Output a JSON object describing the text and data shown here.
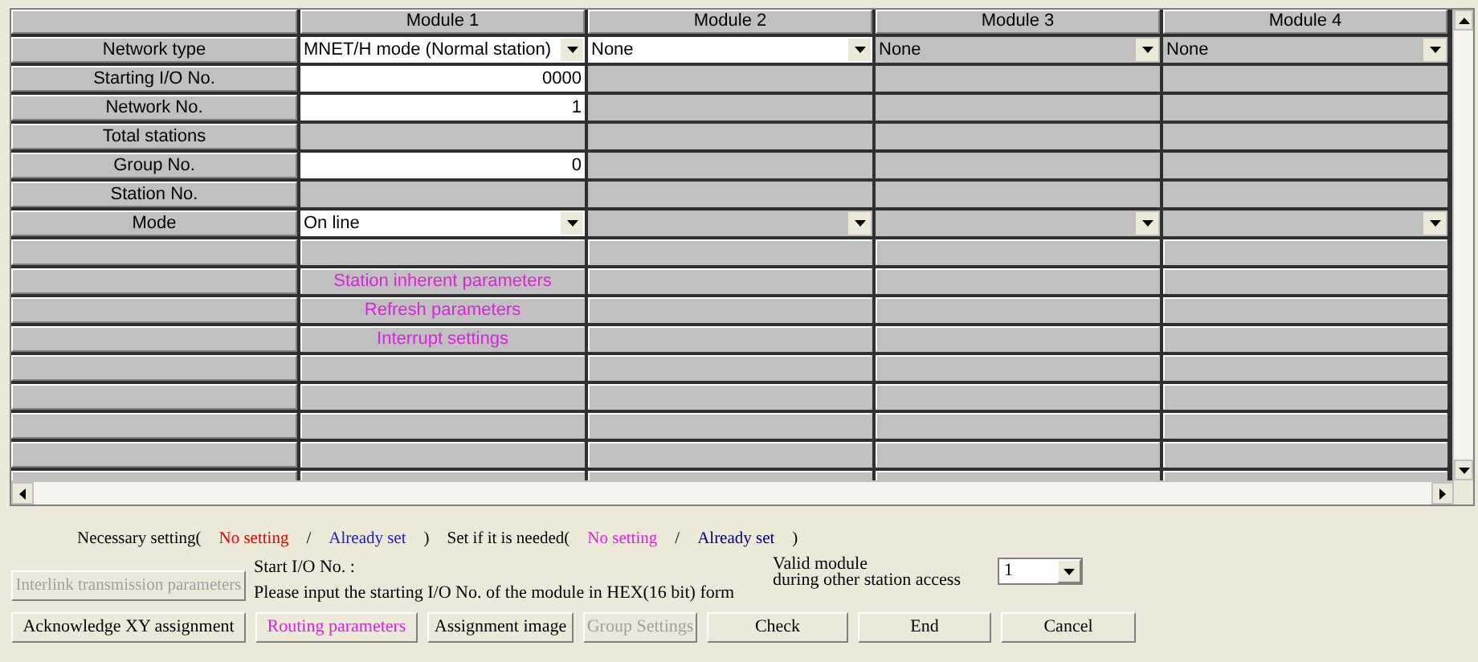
{
  "table": {
    "columns": [
      "Module 1",
      "Module 2",
      "Module 3",
      "Module 4"
    ],
    "rows": [
      {
        "label": "Network type",
        "cells": [
          {
            "kind": "select",
            "value": "MNET/H mode (Normal station)",
            "disabled": false
          },
          {
            "kind": "select",
            "value": "None",
            "disabled": false
          },
          {
            "kind": "select",
            "value": "None",
            "disabled": true
          },
          {
            "kind": "select",
            "value": "None",
            "disabled": true
          }
        ]
      },
      {
        "label": "Starting I/O No.",
        "cells": [
          {
            "kind": "input",
            "value": "0000"
          },
          {
            "kind": "empty"
          },
          {
            "kind": "empty"
          },
          {
            "kind": "empty"
          }
        ]
      },
      {
        "label": "Network No.",
        "cells": [
          {
            "kind": "input",
            "value": "1"
          },
          {
            "kind": "empty"
          },
          {
            "kind": "empty"
          },
          {
            "kind": "empty"
          }
        ]
      },
      {
        "label": "Total stations",
        "cells": [
          {
            "kind": "empty"
          },
          {
            "kind": "empty"
          },
          {
            "kind": "empty"
          },
          {
            "kind": "empty"
          }
        ]
      },
      {
        "label": "Group No.",
        "cells": [
          {
            "kind": "input",
            "value": "0"
          },
          {
            "kind": "empty"
          },
          {
            "kind": "empty"
          },
          {
            "kind": "empty"
          }
        ]
      },
      {
        "label": "Station No.",
        "cells": [
          {
            "kind": "empty"
          },
          {
            "kind": "empty"
          },
          {
            "kind": "empty"
          },
          {
            "kind": "empty"
          }
        ]
      },
      {
        "label": "Mode",
        "cells": [
          {
            "kind": "select",
            "value": "On line",
            "disabled": false
          },
          {
            "kind": "select",
            "disabled": true
          },
          {
            "kind": "select",
            "disabled": true
          },
          {
            "kind": "select",
            "disabled": true
          }
        ]
      },
      {
        "cells": [
          {
            "kind": "button"
          },
          {
            "kind": "button"
          },
          {
            "kind": "button"
          },
          {
            "kind": "button"
          }
        ]
      },
      {
        "cells": [
          {
            "kind": "button",
            "label": "Station inherent parameters",
            "color": "#e020e0"
          },
          {
            "kind": "button"
          },
          {
            "kind": "button"
          },
          {
            "kind": "button"
          }
        ]
      },
      {
        "cells": [
          {
            "kind": "button",
            "label": "Refresh parameters",
            "color": "#e020e0"
          },
          {
            "kind": "button"
          },
          {
            "kind": "button"
          },
          {
            "kind": "button"
          }
        ]
      },
      {
        "cells": [
          {
            "kind": "button",
            "label": "Interrupt settings",
            "color": "#e020e0"
          },
          {
            "kind": "button"
          },
          {
            "kind": "button"
          },
          {
            "kind": "button"
          }
        ]
      },
      {
        "cells": [
          {
            "kind": "button"
          },
          {
            "kind": "button"
          },
          {
            "kind": "button"
          },
          {
            "kind": "button"
          }
        ]
      },
      {
        "cells": [
          {
            "kind": "button"
          },
          {
            "kind": "button"
          },
          {
            "kind": "button"
          },
          {
            "kind": "button"
          }
        ]
      },
      {
        "cells": [
          {
            "kind": "button"
          },
          {
            "kind": "button"
          },
          {
            "kind": "button"
          },
          {
            "kind": "button"
          }
        ]
      },
      {
        "cells": [
          {
            "kind": "button"
          },
          {
            "kind": "button"
          },
          {
            "kind": "button"
          },
          {
            "kind": "button"
          }
        ]
      },
      {
        "cells": [
          {
            "kind": "button"
          },
          {
            "kind": "button"
          },
          {
            "kind": "button"
          },
          {
            "kind": "button"
          }
        ]
      }
    ]
  },
  "legend": [
    {
      "text": "Necessary setting("
    },
    {
      "text": "No setting",
      "color": "#e00000"
    },
    {
      "text": "/"
    },
    {
      "text": "Already set",
      "color": "#2020c0"
    },
    {
      "text": ")"
    },
    {
      "text": "Set if it is needed("
    },
    {
      "text": "No setting",
      "color": "#e020e0"
    },
    {
      "text": "/"
    },
    {
      "text": "Already set",
      "color": "#000080"
    },
    {
      "text": ")"
    }
  ],
  "hint": {
    "title": "Start I/O No. :",
    "text": "Please input the starting I/O No. of the module in HEX(16 bit) form"
  },
  "valid_module": {
    "label_lines": [
      "Valid module",
      "during other station access"
    ],
    "value": "1"
  },
  "side_button": {
    "label": "Interlink transmission parameters",
    "disabled": true
  },
  "buttons": [
    {
      "label": "Acknowledge XY assignment",
      "disabled": false
    },
    {
      "label": "Routing parameters",
      "disabled": false,
      "color": "#e020e0"
    },
    {
      "label": "Assignment image",
      "disabled": false
    },
    {
      "label": "Group Settings",
      "disabled": true
    },
    {
      "label": "Check",
      "disabled": false
    },
    {
      "label": "End",
      "disabled": false
    },
    {
      "label": "Cancel",
      "disabled": false
    }
  ]
}
